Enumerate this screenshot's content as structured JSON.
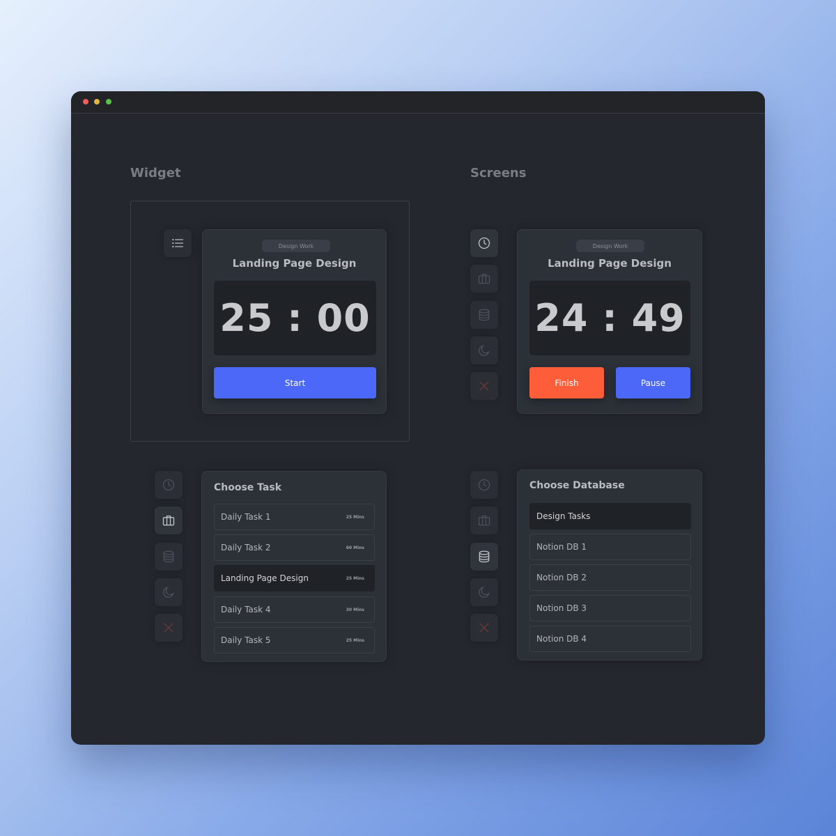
{
  "sections": {
    "widget": "Widget",
    "screens": "Screens"
  },
  "widget_timer": {
    "category": "Design Work",
    "title": "Landing Page Design",
    "time": "25 : 00",
    "start_label": "Start"
  },
  "screen_timer": {
    "category": "Design Work",
    "title": "Landing Page Design",
    "time": "24 : 49",
    "finish_label": "Finish",
    "pause_label": "Pause"
  },
  "choose_task": {
    "title": "Choose Task",
    "items": [
      {
        "label": "Daily Task 1",
        "duration": "25 Mins",
        "selected": false
      },
      {
        "label": "Daily Task 2",
        "duration": "60 Mins",
        "selected": false
      },
      {
        "label": "Landing Page Design",
        "duration": "25 Mins",
        "selected": true
      },
      {
        "label": "Daily Task 4",
        "duration": "30 Mins",
        "selected": false
      },
      {
        "label": "Daily Task 5",
        "duration": "25 Mins",
        "selected": false
      }
    ]
  },
  "choose_database": {
    "title": "Choose Database",
    "items": [
      {
        "label": "Design Tasks",
        "selected": true
      },
      {
        "label": "Notion DB 1",
        "selected": false
      },
      {
        "label": "Notion DB 2",
        "selected": false
      },
      {
        "label": "Notion DB 3",
        "selected": false
      },
      {
        "label": "Notion DB 4",
        "selected": false
      }
    ]
  },
  "icons": [
    "menu-icon",
    "clock-icon",
    "briefcase-icon",
    "database-icon",
    "moon-icon",
    "close-icon"
  ],
  "colors": {
    "accent_blue": "#4b68f8",
    "accent_orange": "#fe5d3a",
    "close_red": "#8a3a35",
    "window_bg": "#24282e"
  }
}
